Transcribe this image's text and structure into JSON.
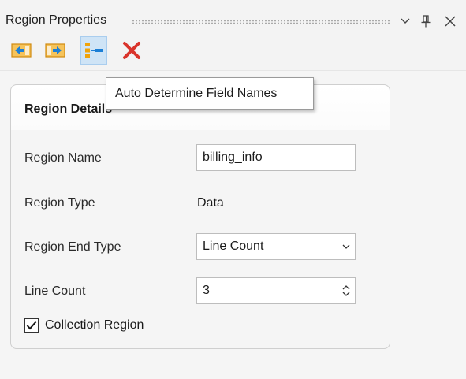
{
  "panel": {
    "title": "Region Properties"
  },
  "title_buttons": [
    {
      "icon": "chevron-down-icon"
    },
    {
      "icon": "pin-icon"
    },
    {
      "icon": "close-icon"
    }
  ],
  "toolbar": {
    "buttons": [
      {
        "icon": "arrow-left-icon",
        "name": "previous-region"
      },
      {
        "icon": "arrow-right-icon",
        "name": "next-region"
      },
      {
        "icon": "auto-field-names-icon",
        "name": "auto-determine-field-names",
        "active": true
      },
      {
        "icon": "delete-icon",
        "name": "delete-region"
      }
    ]
  },
  "tooltip": {
    "text": "Auto Determine Field Names"
  },
  "details": {
    "title": "Region Details",
    "region_name_label": "Region Name",
    "region_name_value": "billing_info",
    "region_type_label": "Region Type",
    "region_type_value": "Data",
    "region_end_type_label": "Region End Type",
    "region_end_type_value": "Line Count",
    "line_count_label": "Line Count",
    "line_count_value": "3",
    "collection_region_label": "Collection Region",
    "collection_region_checked": true
  },
  "colors": {
    "accent_arrow": "#f0a30a",
    "accent_blue": "#1c7fd6",
    "delete_red": "#d9342b",
    "active_button_bg": "#cfe4f6"
  }
}
